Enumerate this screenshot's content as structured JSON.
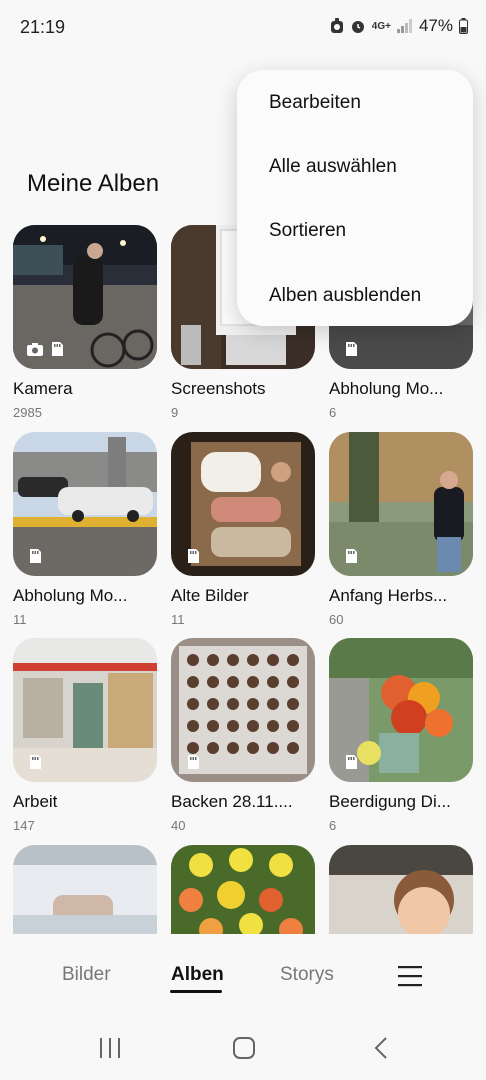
{
  "status_bar": {
    "time": "21:19",
    "network": "4G+",
    "battery": "47%"
  },
  "section_title": "Meine Alben",
  "menu": {
    "items": [
      "Bearbeiten",
      "Alle auswählen",
      "Sortieren",
      "Alben ausblenden"
    ]
  },
  "albums": [
    {
      "name": "Kamera",
      "count": "2985"
    },
    {
      "name": "Screenshots",
      "count": "9"
    },
    {
      "name": "Abholung Mo...",
      "count": "6"
    },
    {
      "name": "Abholung Mo...",
      "count": "11"
    },
    {
      "name": "Alte Bilder",
      "count": "11"
    },
    {
      "name": "Anfang Herbs...",
      "count": "60"
    },
    {
      "name": "Arbeit",
      "count": "147"
    },
    {
      "name": "Backen 28.11....",
      "count": "40"
    },
    {
      "name": "Beerdigung Di...",
      "count": "6"
    }
  ],
  "bottom_nav": {
    "tabs": [
      "Bilder",
      "Alben",
      "Storys"
    ],
    "active": "Alben"
  }
}
